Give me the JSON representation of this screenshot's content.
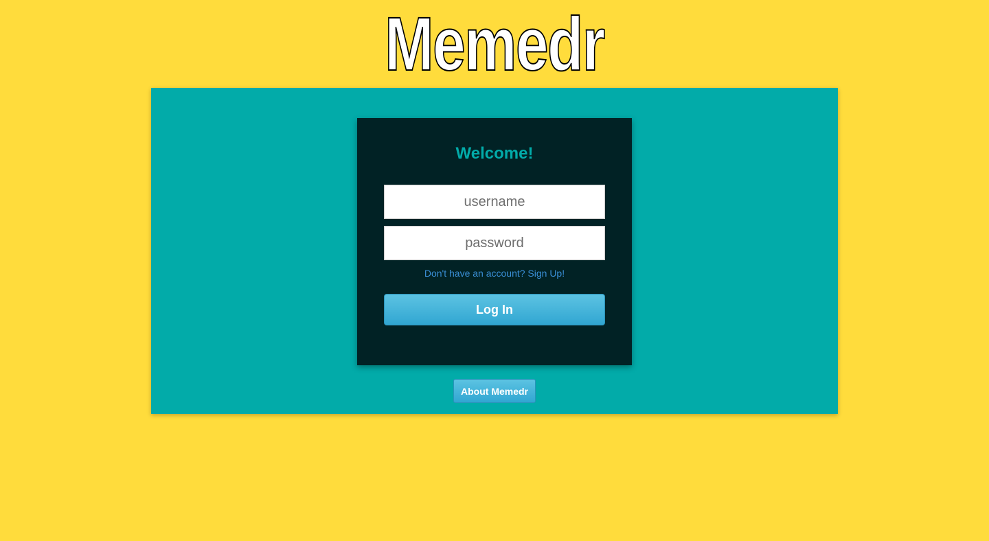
{
  "app": {
    "logo_text": "Memedr"
  },
  "colors": {
    "page_background": "#ffdc3c",
    "panel_background": "#02aba9",
    "card_background": "#012225",
    "button_blue": "#31a6d2",
    "link_blue": "#3a8fd6"
  },
  "login": {
    "heading": "Welcome!",
    "username_placeholder": "username",
    "password_placeholder": "password",
    "username_value": "",
    "password_value": "",
    "signup_link": "Don't have an account? Sign Up!",
    "login_button": "Log In"
  },
  "footer": {
    "about_button": "About Memedr"
  }
}
